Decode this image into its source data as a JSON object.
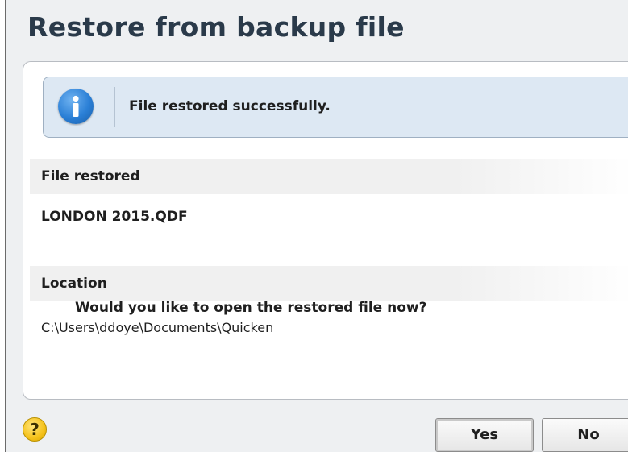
{
  "dialog": {
    "title": "Restore from backup file"
  },
  "banner": {
    "icon": "info-icon",
    "message": "File restored successfully."
  },
  "file_section": {
    "header": "File restored",
    "value": "LONDON 2015.QDF"
  },
  "location_section": {
    "header": "Location",
    "value": "C:\\Users\\ddoye\\Documents\\Quicken"
  },
  "question": "Would you like to open the restored file now?",
  "footer": {
    "help_icon": "help-icon",
    "help_glyph": "?",
    "yes_label": "Yes",
    "no_label": "No"
  },
  "colors": {
    "banner_bg": "#dde8f3",
    "info_icon": "#2a7fd6",
    "help_icon": "#f5c21b",
    "title_text": "#2a3a4a"
  }
}
